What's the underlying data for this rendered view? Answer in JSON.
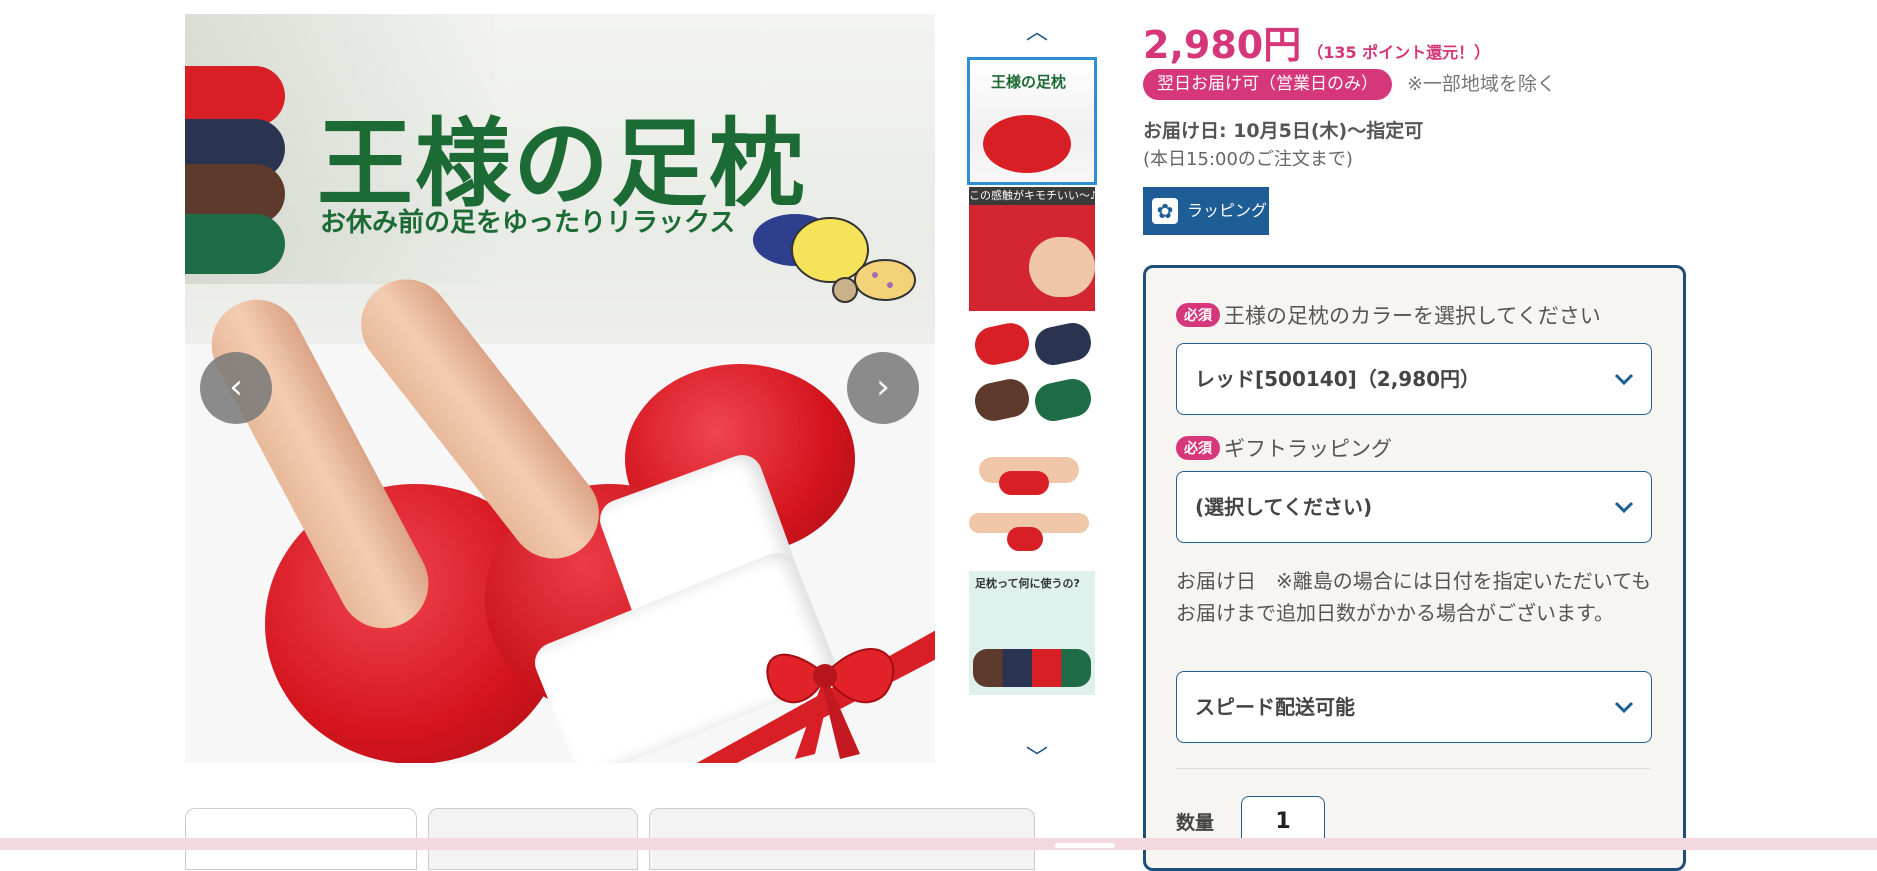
{
  "hero": {
    "title": "王様の足枕",
    "subtitle": "お休み前の足をゆったりリラックス",
    "prev_label": "‹",
    "next_label": "›"
  },
  "thumbnails": {
    "up_label": "︿",
    "down_label": "﹀",
    "items": [
      {
        "caption": "王様の足枕"
      },
      {
        "caption": "この感触がキモチいい～♪"
      },
      {
        "caption": ""
      },
      {
        "caption": ""
      },
      {
        "caption": "足枕って何に使うの?"
      }
    ]
  },
  "product": {
    "price": "2,980円",
    "points": "（135 ポイント還元！）",
    "next_day_badge": "翌日お届け可（営業日のみ）",
    "exclude_note": "※一部地域を除く",
    "delivery_date": "お届け日: 10月5日(木)〜指定可",
    "cutoff": "(本日15:00のご注文まで)",
    "wrapping_button": "ラッピング"
  },
  "form": {
    "required_label": "必須",
    "color_label": "王様の足枕のカラーを選択してください",
    "color_value": "レッド[500140]（2,980円）",
    "gift_label": "ギフトラッピング",
    "gift_value": "(選択してください)",
    "delivery_note": "お届け日　※離島の場合には日付を指定いただいてもお届けまで追加日数がかかる場合がございます。",
    "delivery_value": "スピード配送可能",
    "quantity_label": "数量",
    "quantity_value": "1"
  },
  "colors": {
    "accent": "#d6367a",
    "brand_blue": "#1f5d96",
    "title_green": "#1c6b35"
  }
}
